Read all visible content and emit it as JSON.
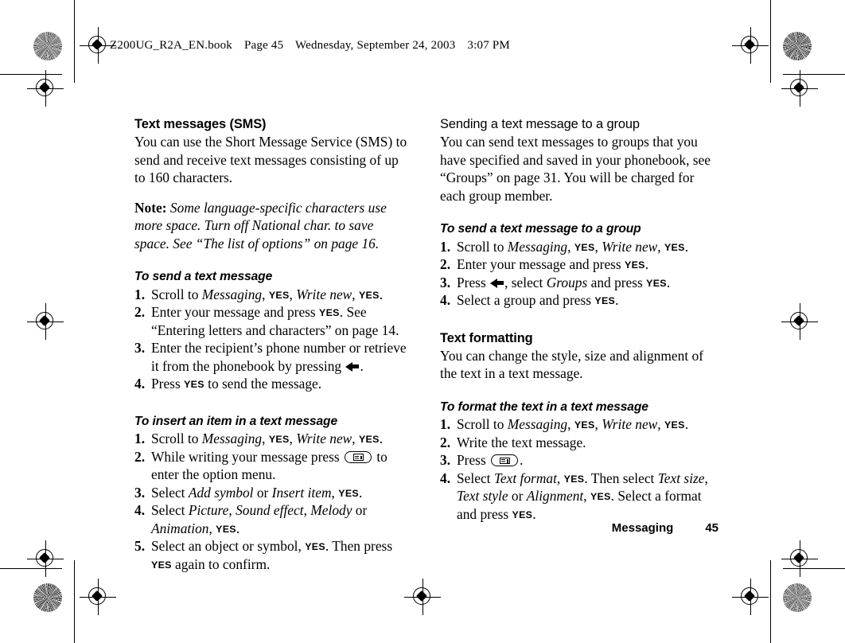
{
  "book_line": {
    "filename": "Z200UG_R2A_EN.book",
    "page": "Page 45",
    "weekday_date": "Wednesday, September 24, 2003",
    "time": "3:07 PM"
  },
  "footer": {
    "section": "Messaging",
    "page_number": "45"
  },
  "left_column": {
    "heading": "Text messages (SMS)",
    "intro": "You can use the Short Message Service (SMS) to send and receive text messages consisting of up to 160 characters.",
    "note_label": "Note:",
    "note_text": "Some language-specific characters use more space. Turn off National char. to save space. See “The list of options” on page 16.",
    "proc1_title": "To send a text message",
    "proc1_steps": [
      "Scroll to Messaging, YES, Write new, YES.",
      "Enter your message and press YES. See “Entering letters and characters” on page 14.",
      "Enter the recipient’s phone number or retrieve it from the phonebook by pressing [back-arrow].",
      "Press YES to send the message."
    ],
    "proc2_title": "To insert an item in a text message",
    "proc2_steps": [
      "Scroll to Messaging, YES, Write new, YES.",
      "While writing your message press [menu-key] to enter the option menu.",
      "Select Add symbol or Insert item, YES.",
      "Select Picture, Sound effect, Melody or Animation, YES.",
      "Select an object or symbol, YES. Then press YES again to confirm."
    ]
  },
  "right_column": {
    "heading": "Sending a text message to a group",
    "intro": "You can send text messages to groups that you have specified and saved in your phonebook, see “Groups” on page 31. You will be charged for each group member.",
    "proc1_title": "To send a text message to a group",
    "proc1_steps": [
      "Scroll to Messaging, YES, Write new, YES.",
      "Enter your message and press YES.",
      "Press [back-arrow], select Groups and press YES.",
      "Select a group and press YES."
    ],
    "heading2": "Text formatting",
    "intro2": "You can change the style, size and alignment of the text in a text message.",
    "proc2_title": "To format the text in a text message",
    "proc2_steps": [
      "Scroll to Messaging, YES, Write new, YES.",
      "Write the text message.",
      "Press [menu-key].",
      "Select Text format, YES. Then select Text size, Text style or Alignment, YES. Select a format and press YES."
    ]
  },
  "inline_tokens": {
    "key_yes": "YES",
    "icon_back_arrow": "back-arrow-icon",
    "icon_menu_key": "menu-key-icon"
  },
  "colors": {
    "ink": "#000000",
    "paper": "#ffffff"
  }
}
